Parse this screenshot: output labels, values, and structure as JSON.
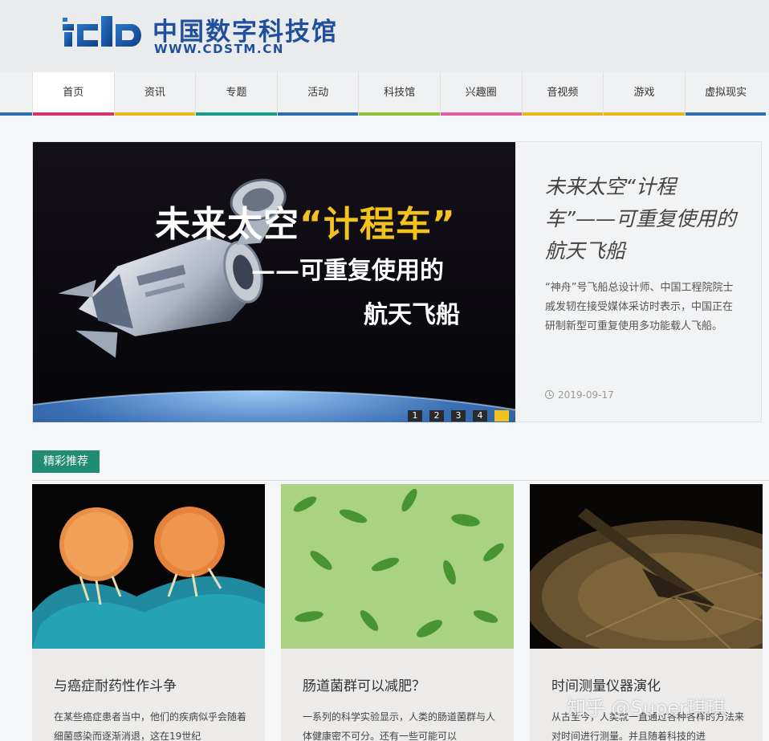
{
  "header": {
    "logo_mark": "cdstm-logo-mark",
    "site_name": "中国数字科技馆",
    "site_url": "WWW.CDSTM.CN",
    "brand_color": "#1f4f9d"
  },
  "nav": {
    "items": [
      {
        "label": "首页",
        "color": "#d8336b"
      },
      {
        "label": "资讯",
        "color": "#e8b81a"
      },
      {
        "label": "专题",
        "color": "#1d9a86"
      },
      {
        "label": "活动",
        "color": "#2d6db2"
      },
      {
        "label": "科技馆",
        "color": "#8fbf34"
      },
      {
        "label": "兴趣圈",
        "color": "#e060a0"
      },
      {
        "label": "音视频",
        "color": "#e8b81a"
      },
      {
        "label": "游戏",
        "color": "#e8b81a"
      },
      {
        "label": "虚拟现实",
        "color": "#2d6db2"
      }
    ]
  },
  "hero": {
    "image_title_part1": "未来太空",
    "image_title_highlight": "“计程车”",
    "image_sub1": "——可重复使用的",
    "image_sub2": "航天飞船",
    "title": "未来太空“计程车”——可重复使用的航天飞船",
    "description": "“神舟”号飞船总设计师、中国工程院院士戚发轫在接受媒体采访时表示，中国正在研制新型可重复使用多功能载人飞船。",
    "date": "2019-09-17",
    "pager": [
      "1",
      "2",
      "3",
      "4",
      "5"
    ],
    "active_page": 5
  },
  "section": {
    "label": "精彩推荐",
    "accent": "#1f8c73"
  },
  "cards": [
    {
      "title": "与癌症耐药性作斗争",
      "description": "在某些癌症患者当中，他们的疾病似乎会随着细菌感染而逐渐消退，这在19世纪"
    },
    {
      "title": "肠道菌群可以减肥？",
      "description": "一系列的科学实验显示，人类的肠道菌群与人体健康密不可分。还有一些可能可以"
    },
    {
      "title": "时间测量仪器演化",
      "description": "从古至今，人类就一直通过各种各样的方法来对时间进行测量。并且随着科技的进"
    }
  ],
  "watermark": "知乎 @Super琪琪"
}
